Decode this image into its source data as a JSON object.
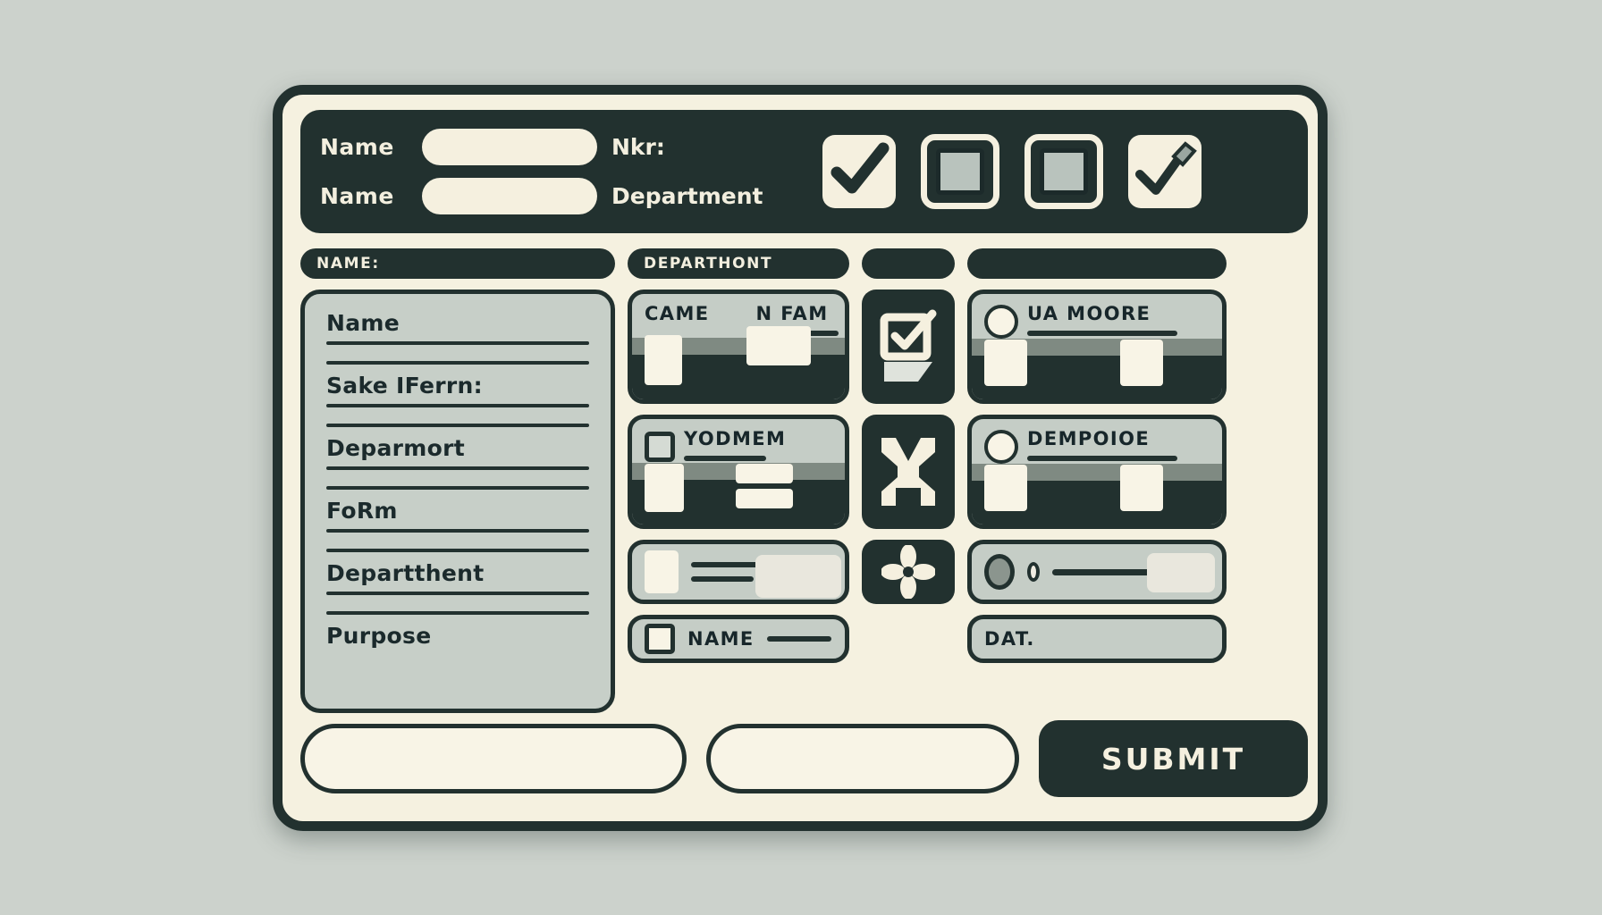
{
  "header": {
    "rows": [
      {
        "label": "Name",
        "tail": "Nkr:"
      },
      {
        "label": "Name",
        "tail": "Department"
      }
    ],
    "icons": [
      {
        "name": "checkbox-checked-icon",
        "kind": "check"
      },
      {
        "name": "checkbox-empty-icon",
        "kind": "square"
      },
      {
        "name": "checkbox-empty-icon",
        "kind": "square"
      },
      {
        "name": "checkbox-pen-icon",
        "kind": "pen-check"
      }
    ]
  },
  "columns": {
    "left": {
      "tag": "NAME:",
      "fields": [
        {
          "label": "Name"
        },
        {
          "label": "Sake IFerrn:"
        },
        {
          "label": "Deparmort"
        },
        {
          "label": "FoRm"
        },
        {
          "label": "Departthent"
        },
        {
          "label": "Purpose"
        }
      ]
    },
    "middle": {
      "tag": "DEPARTHONT",
      "cards": [
        {
          "title_a": "CAME",
          "title_b": "N FAM"
        },
        {
          "title_a": "YODMEM",
          "title_b": ""
        }
      ],
      "slider_card": {
        "label": ""
      },
      "bottom_card": {
        "label": "NAME"
      }
    },
    "icons_column": {
      "tag": "",
      "tiles": [
        {
          "name": "form-checkbox-icon"
        },
        {
          "name": "h-frame-icon"
        },
        {
          "name": "flower-move-icon"
        }
      ]
    },
    "right": {
      "cards": [
        {
          "title": "UA MOORE"
        },
        {
          "title": "DEMPOIOE"
        }
      ],
      "slider_card": {
        "label": ""
      },
      "bottom_card": {
        "label": "DAT."
      }
    }
  },
  "footer": {
    "input_a": "",
    "input_b": "",
    "submit_label": "SUBMIT"
  },
  "colors": {
    "page_bg": "#ccd2cc",
    "panel_bg": "#f5f1e0",
    "ink": "#22312f",
    "card_bg": "#c5cdc6",
    "cream": "#f8f4e6",
    "stripe": "#7f8a82"
  }
}
